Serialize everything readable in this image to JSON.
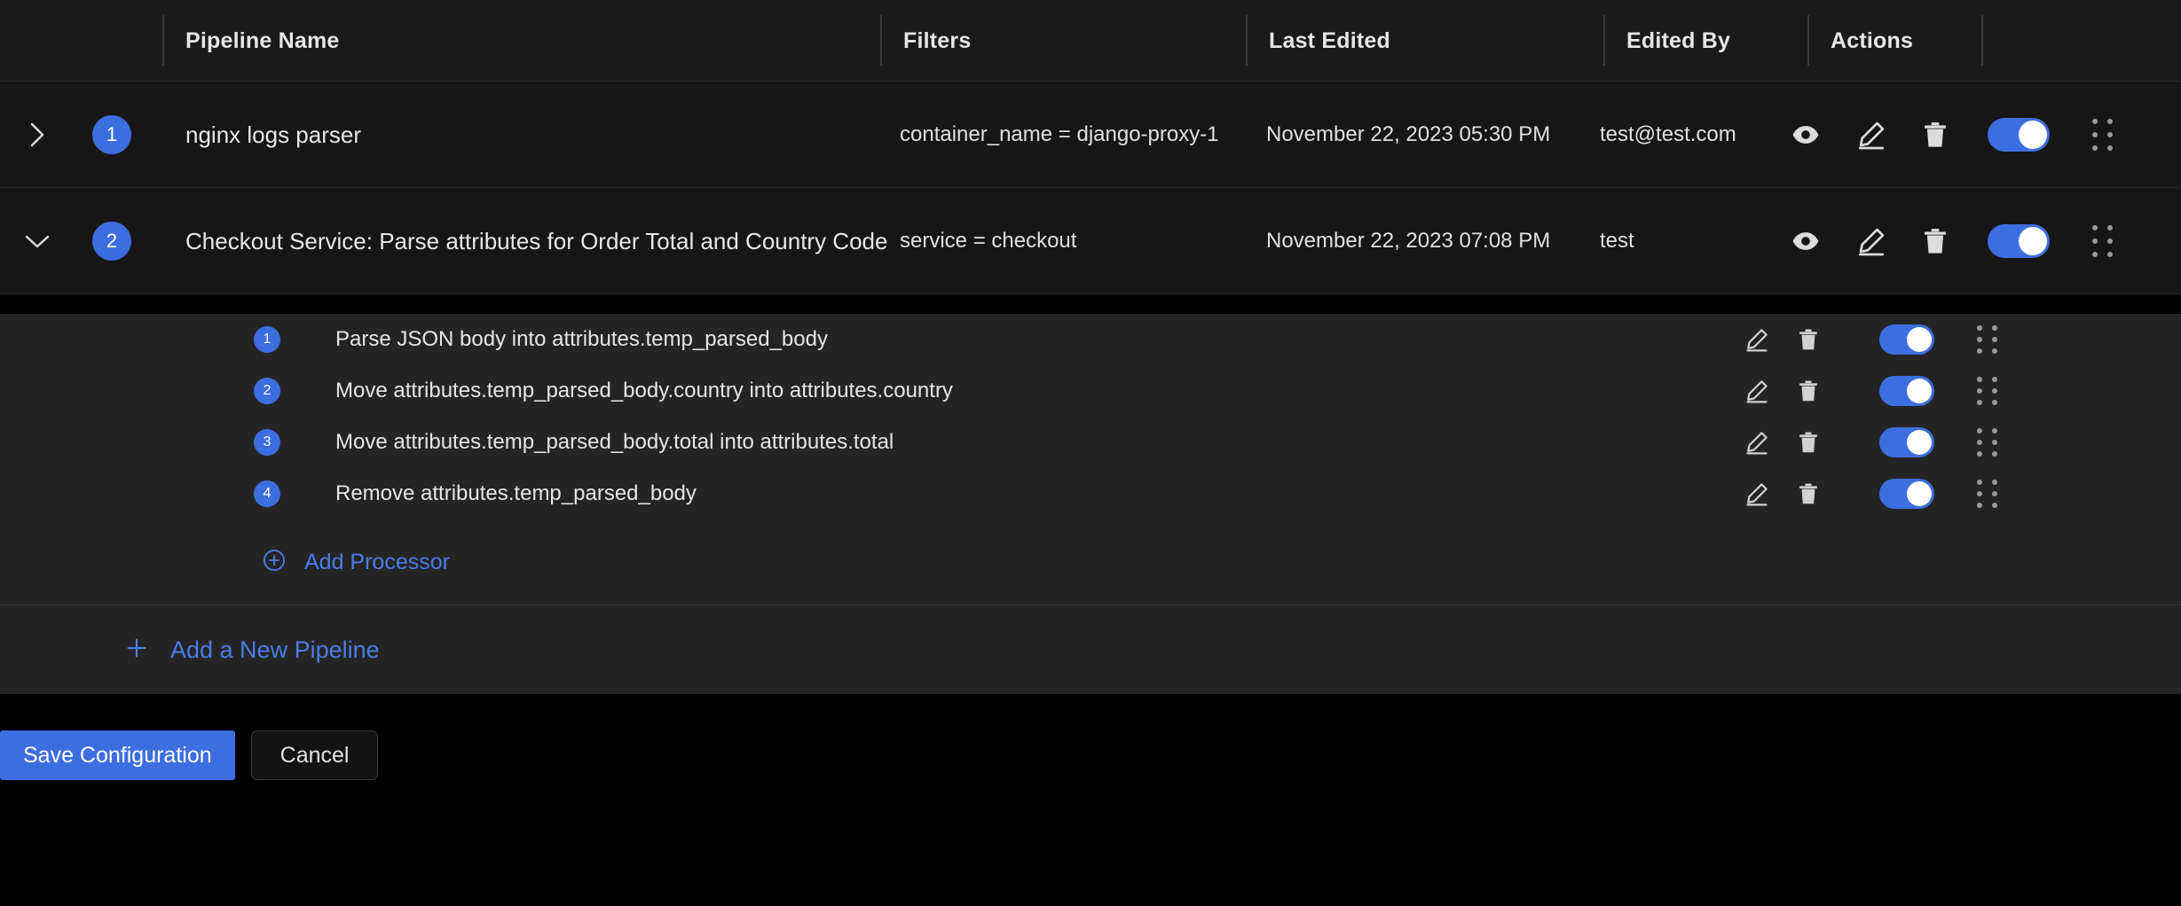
{
  "table": {
    "columns": [
      {
        "key": "pipeline_name",
        "label": "Pipeline Name"
      },
      {
        "key": "filters",
        "label": "Filters"
      },
      {
        "key": "last_edited",
        "label": "Last Edited"
      },
      {
        "key": "edited_by",
        "label": "Edited By"
      },
      {
        "key": "actions",
        "label": "Actions"
      }
    ]
  },
  "pipelines": [
    {
      "order": "1",
      "name": "nginx logs parser",
      "filter": "container_name = django-proxy-1",
      "last_edited": "November 22, 2023 05:30 PM",
      "edited_by": "test@test.com",
      "expanded": false,
      "enabled": true,
      "chevron": "chevron-right-icon"
    },
    {
      "order": "2",
      "name": "Checkout Service: Parse attributes for Order Total and Country Code",
      "filter": "service = checkout",
      "last_edited": "November 22, 2023 07:08 PM",
      "edited_by": "test",
      "expanded": true,
      "enabled": true,
      "chevron": "chevron-down-icon"
    }
  ],
  "processors": [
    {
      "order": "1",
      "name": "Parse JSON body into attributes.temp_parsed_body",
      "enabled": true
    },
    {
      "order": "2",
      "name": "Move attributes.temp_parsed_body.country into attributes.country",
      "enabled": true
    },
    {
      "order": "3",
      "name": "Move attributes.temp_parsed_body.total into attributes.total",
      "enabled": true
    },
    {
      "order": "4",
      "name": "Remove attributes.temp_parsed_body",
      "enabled": true
    }
  ],
  "links": {
    "add_processor": "Add Processor",
    "add_pipeline": "Add a New Pipeline"
  },
  "footer": {
    "save_label": "Save Configuration",
    "cancel_label": "Cancel"
  },
  "icons": {
    "view": "eye-icon",
    "edit": "pencil-icon",
    "delete": "trash-icon",
    "toggle": "toggle-switch",
    "drag": "drag-handle-icon",
    "add_processor": "plus-circle-icon",
    "add_pipeline": "plus-icon"
  },
  "colors": {
    "accent": "#3d6ee0",
    "link": "#4a7ce8",
    "row_bg": "#161616",
    "panel_bg": "#242424",
    "header_bg": "#1a1a1a",
    "page_bg": "#000000"
  }
}
